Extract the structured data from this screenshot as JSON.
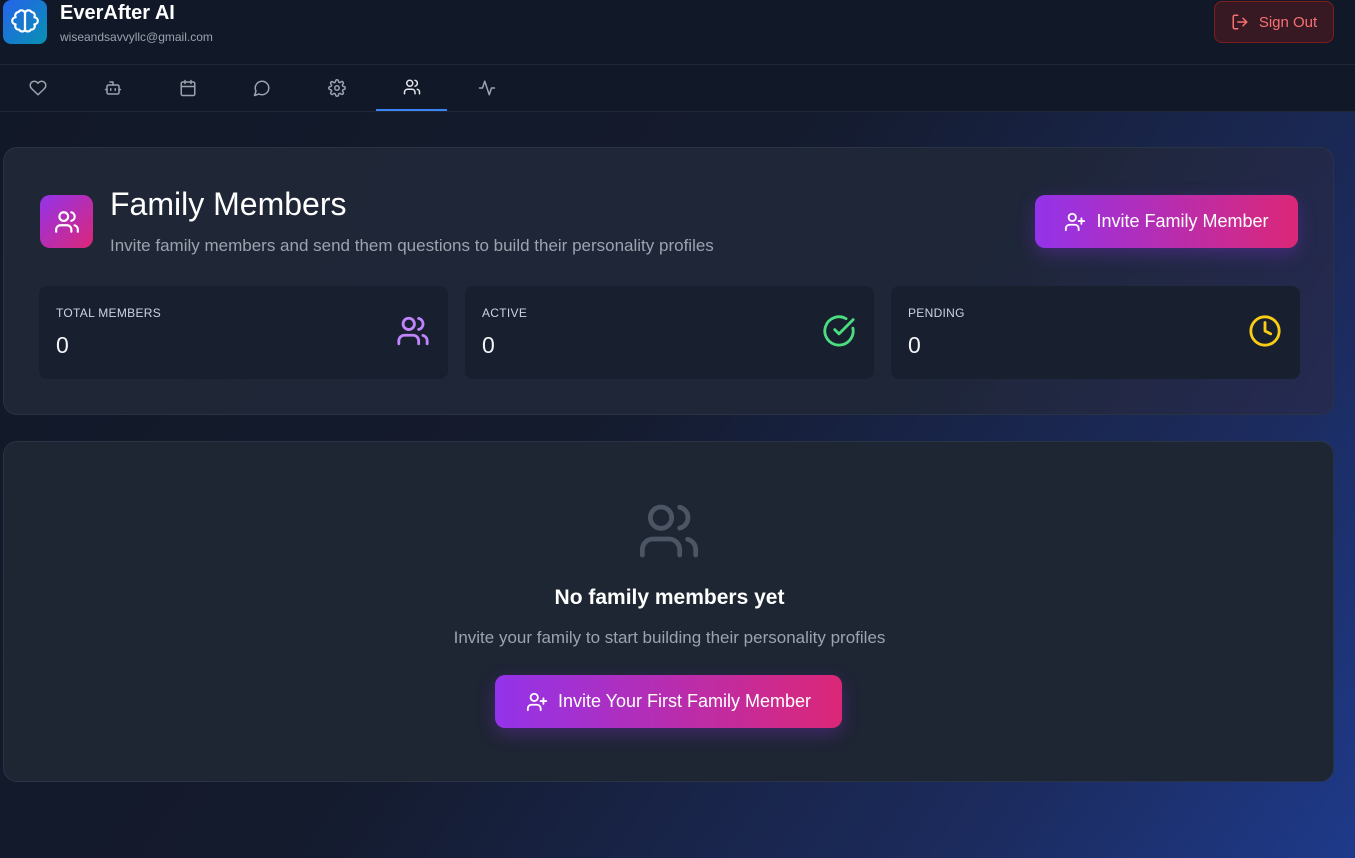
{
  "app": {
    "title": "EverAfter AI",
    "email": "wiseandsavvyllc@gmail.com",
    "logo_icon": "brain-icon",
    "sign_out_label": "Sign Out"
  },
  "tabs": [
    {
      "icon": "heart-icon",
      "active": false
    },
    {
      "icon": "bot-icon",
      "active": false
    },
    {
      "icon": "calendar-icon",
      "active": false
    },
    {
      "icon": "chat-icon",
      "active": false
    },
    {
      "icon": "gear-icon",
      "active": false
    },
    {
      "icon": "users-icon",
      "active": true
    },
    {
      "icon": "activity-icon",
      "active": false
    }
  ],
  "family": {
    "title": "Family Members",
    "subtitle": "Invite family members and send them questions to build their personality profiles",
    "invite_label": "Invite Family Member",
    "stats": [
      {
        "label": "TOTAL MEMBERS",
        "value": "0",
        "icon": "users-icon",
        "color": "#c084fc"
      },
      {
        "label": "ACTIVE",
        "value": "0",
        "icon": "check-circle-icon",
        "color": "#4ade80"
      },
      {
        "label": "PENDING",
        "value": "0",
        "icon": "clock-icon",
        "color": "#facc15"
      }
    ]
  },
  "empty_state": {
    "title": "No family members yet",
    "subtitle": "Invite your family to start building their personality profiles",
    "button_label": "Invite Your First Family Member"
  },
  "colors": {
    "accent_gradient_start": "#9333ea",
    "accent_gradient_end": "#db2777",
    "active_tab": "#3b82f6",
    "danger": "#f87171"
  }
}
